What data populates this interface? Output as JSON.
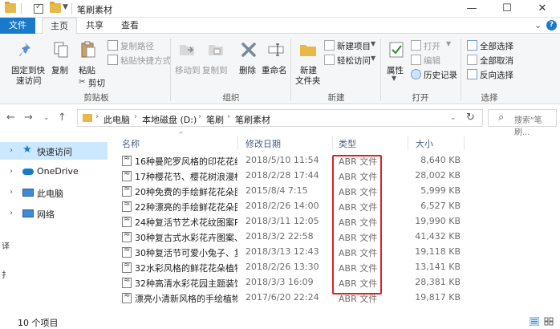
{
  "window": {
    "title": "笔刷素材",
    "minimize_glyph": "—",
    "maximize_glyph": "☐",
    "close_glyph": "✕"
  },
  "ribbon_tabs": {
    "file": "文件",
    "home": "主页",
    "share": "共享",
    "view": "查看"
  },
  "ribbon": {
    "clipboard": {
      "pin": "固定到快",
      "pin2": "速访问",
      "copy": "复制",
      "paste": "粘贴",
      "copy_path": "复制路径",
      "paste_shortcut": "粘贴快捷方式",
      "cut": "剪切",
      "group": "剪贴板"
    },
    "organize": {
      "move_to": "移动到",
      "copy_to": "复制到",
      "delete": "删除",
      "rename": "重命名",
      "group": "组织"
    },
    "new": {
      "new_folder": "新建",
      "new_folder2": "文件夹",
      "new_item": "新建项目",
      "easy_access": "轻松访问",
      "group": "新建"
    },
    "open": {
      "properties": "属性",
      "open": "打开",
      "edit": "编辑",
      "history": "历史记录",
      "group": "打开"
    },
    "select": {
      "select_all": "全部选择",
      "select_none": "全部取消",
      "invert": "反向选择",
      "group": "选择"
    }
  },
  "address": {
    "crumbs": [
      "此电脑",
      "本地磁盘 (D:)",
      "笔刷",
      "笔刷素材"
    ],
    "search_placeholder": "搜索\"笔刷..."
  },
  "navpane": {
    "items": [
      {
        "label": "快速访问"
      },
      {
        "label": "OneDrive"
      },
      {
        "label": "此电脑"
      },
      {
        "label": "网络"
      }
    ]
  },
  "columns": {
    "name": "名称",
    "date": "修改日期",
    "type": "类型",
    "size": "大小"
  },
  "files": [
    {
      "name": "16种曼陀罗风格的印花花纹...",
      "date": "2018/5/10 11:54",
      "type": "ABR 文件",
      "size": "8,640 KB"
    },
    {
      "name": "17种樱花节、樱花树浪漫樱...",
      "date": "2018/2/28 17:44",
      "type": "ABR 文件",
      "size": "28,002 KB"
    },
    {
      "name": "20种免费的手绘鲜花花朵图...",
      "date": "2015/8/4 7:15",
      "type": "ABR 文件",
      "size": "5,999 KB"
    },
    {
      "name": "22种漂亮的手绘鲜花花朵图...",
      "date": "2018/2/26 14:00",
      "type": "ABR 文件",
      "size": "6,527 KB"
    },
    {
      "name": "24种复活节艺术花纹图案Ph...",
      "date": "2018/3/11 12:05",
      "type": "ABR 文件",
      "size": "19,990 KB"
    },
    {
      "name": "30种复古式水彩花卉图案、...",
      "date": "2018/3/2 22:58",
      "type": "ABR 文件",
      "size": "41,432 KB"
    },
    {
      "name": "30种复活节可爱小兔子、复...",
      "date": "2018/3/13 12:43",
      "type": "ABR 文件",
      "size": "19,118 KB"
    },
    {
      "name": "32水彩风格的鲜花花朵植物...",
      "date": "2018/2/26 13:30",
      "type": "ABR 文件",
      "size": "13,141 KB"
    },
    {
      "name": "32种高清水彩花园主题装饰...",
      "date": "2018/3/3 16:09",
      "type": "ABR 文件",
      "size": "28,381 KB"
    },
    {
      "name": "漂亮小清新风格的手绘植物...",
      "date": "2017/6/20 22:24",
      "type": "ABR 文件",
      "size": "19,817 KB"
    }
  ],
  "status": {
    "count": "10 个项目"
  },
  "edge_fragments": [
    "译",
    "扌"
  ],
  "colors": {
    "accent": "#1979ca",
    "title_bar": "#ffffff",
    "selection": "#cce8ff",
    "highlight_box": "#e02020"
  }
}
